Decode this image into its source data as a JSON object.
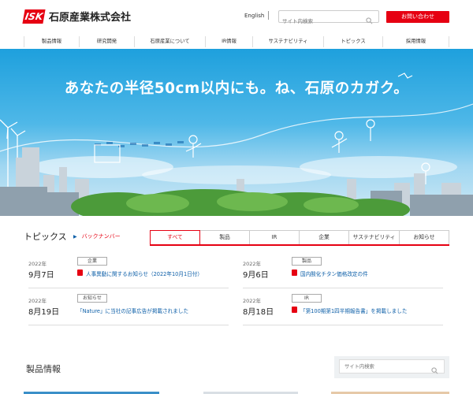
{
  "header": {
    "logo_mark": "ISK",
    "company_name": "石原産業株式会社",
    "lang_link": "English",
    "search_placeholder": "サイト内検索",
    "contact_button": "お問い合わせ"
  },
  "nav": {
    "items": [
      {
        "label": "製品情報"
      },
      {
        "label": "研究開発"
      },
      {
        "label": "石原産業について"
      },
      {
        "label": "IR情報"
      },
      {
        "label": "サステナビリティ"
      },
      {
        "label": "トピックス"
      },
      {
        "label": "採用情報"
      }
    ]
  },
  "hero": {
    "catchphrase": "あなたの半径50cm以内にも。ね、石原のカガク。"
  },
  "topics": {
    "title": "トピックス",
    "backnumber": "バックナンバー",
    "tabs": [
      {
        "label": "すべて",
        "active": true
      },
      {
        "label": "製品",
        "active": false
      },
      {
        "label": "IR",
        "active": false
      },
      {
        "label": "企業",
        "active": false
      },
      {
        "label": "サステナビリティ",
        "active": false
      },
      {
        "label": "お知らせ",
        "active": false
      }
    ],
    "news": [
      {
        "year": "2022年",
        "date": "9月7日",
        "category": "企業",
        "title": "人事異動に関するお知らせ（2022年10月1日付）",
        "pdf": true
      },
      {
        "year": "2022年",
        "date": "9月6日",
        "category": "製品",
        "title": "国内酸化チタン価格改定の件",
        "pdf": true
      },
      {
        "year": "2022年",
        "date": "8月19日",
        "category": "お知らせ",
        "title": "「Nature」に当社の記事広告が掲載されました",
        "pdf": false
      },
      {
        "year": "2022年",
        "date": "8月18日",
        "category": "IR",
        "title": "「第100期第1四半期報告書」を掲載しました",
        "pdf": true
      }
    ]
  },
  "products": {
    "title": "製品情報",
    "search_placeholder": "サイト内検索"
  },
  "colors": {
    "brand_red": "#e60012",
    "link_blue": "#0d5fa8",
    "sky_blue": "#1ea0dd"
  },
  "icons": {
    "search": "magnifier-icon",
    "pdf": "pdf-icon",
    "arrow": "triangle-right-icon"
  }
}
